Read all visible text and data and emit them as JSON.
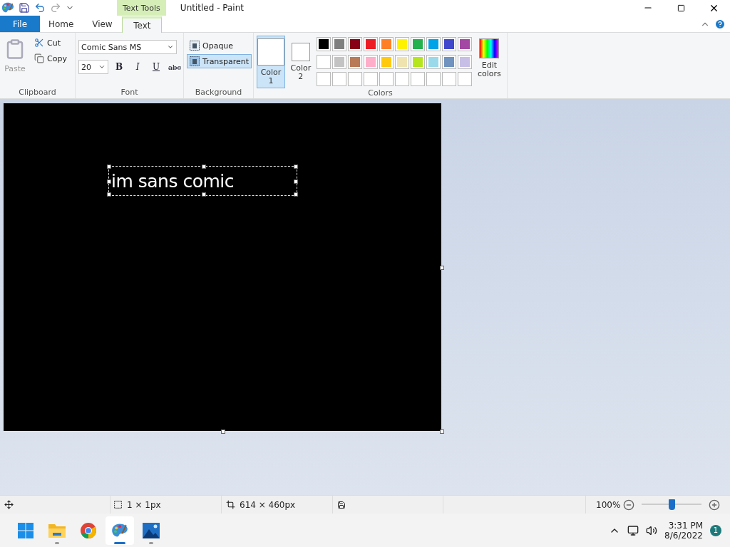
{
  "window": {
    "title": "Untitled - Paint",
    "context_tab": "Text Tools"
  },
  "tabs": [
    {
      "label": "File",
      "kind": "file",
      "selected": false
    },
    {
      "label": "Home",
      "kind": "tab",
      "selected": false
    },
    {
      "label": "View",
      "kind": "tab",
      "selected": false
    },
    {
      "label": "Text",
      "kind": "tab",
      "selected": true
    }
  ],
  "clipboard": {
    "paste": "Paste",
    "cut": "Cut",
    "copy": "Copy",
    "label": "Clipboard"
  },
  "font": {
    "family": "Comic Sans MS",
    "size": "20",
    "bold": "B",
    "italic": "I",
    "underline": "U",
    "strike": "abc",
    "label": "Font"
  },
  "background": {
    "label": "Background",
    "options": [
      {
        "label": "Opaque",
        "selected": false
      },
      {
        "label": "Transparent",
        "selected": true
      }
    ]
  },
  "colors": {
    "label": "Colors",
    "color1": {
      "label": "Color 1",
      "color": "#ffffff",
      "selected": true
    },
    "color2": {
      "label": "Color 2",
      "color": "#ffffff",
      "selected": false
    },
    "edit": "Edit colors",
    "palette": [
      {
        "color": "#000000"
      },
      {
        "color": "#7f7f7f"
      },
      {
        "color": "#880015"
      },
      {
        "color": "#ed1c24"
      },
      {
        "color": "#ff7f27"
      },
      {
        "color": "#fff200"
      },
      {
        "color": "#22b14c"
      },
      {
        "color": "#00a2e8"
      },
      {
        "color": "#3f48cc"
      },
      {
        "color": "#a349a4"
      },
      {
        "color": "#ffffff"
      },
      {
        "color": "#c3c3c3"
      },
      {
        "color": "#b97a57"
      },
      {
        "color": "#ffaec9"
      },
      {
        "color": "#ffc90e"
      },
      {
        "color": "#efe4b0"
      },
      {
        "color": "#b5e61d"
      },
      {
        "color": "#99d9ea"
      },
      {
        "color": "#7092be"
      },
      {
        "color": "#c8bfe7"
      }
    ]
  },
  "canvas": {
    "text": "im sans comic"
  },
  "status_bar": {
    "selection": "1 × 1px",
    "size": "614 × 460px",
    "zoom": "100%",
    "zoom_slider": {
      "level": 0.5
    }
  },
  "taskbar": {
    "apps": [
      {
        "kind": "start",
        "selected": false,
        "running": false
      },
      {
        "kind": "explorer",
        "selected": false,
        "running": true
      },
      {
        "kind": "chrome",
        "selected": false,
        "running": false
      },
      {
        "kind": "paint",
        "selected": true,
        "running": true
      },
      {
        "kind": "photos",
        "selected": false,
        "running": true
      }
    ],
    "time": "3:31 PM",
    "date": "8/6/2022",
    "notifications": "1"
  }
}
